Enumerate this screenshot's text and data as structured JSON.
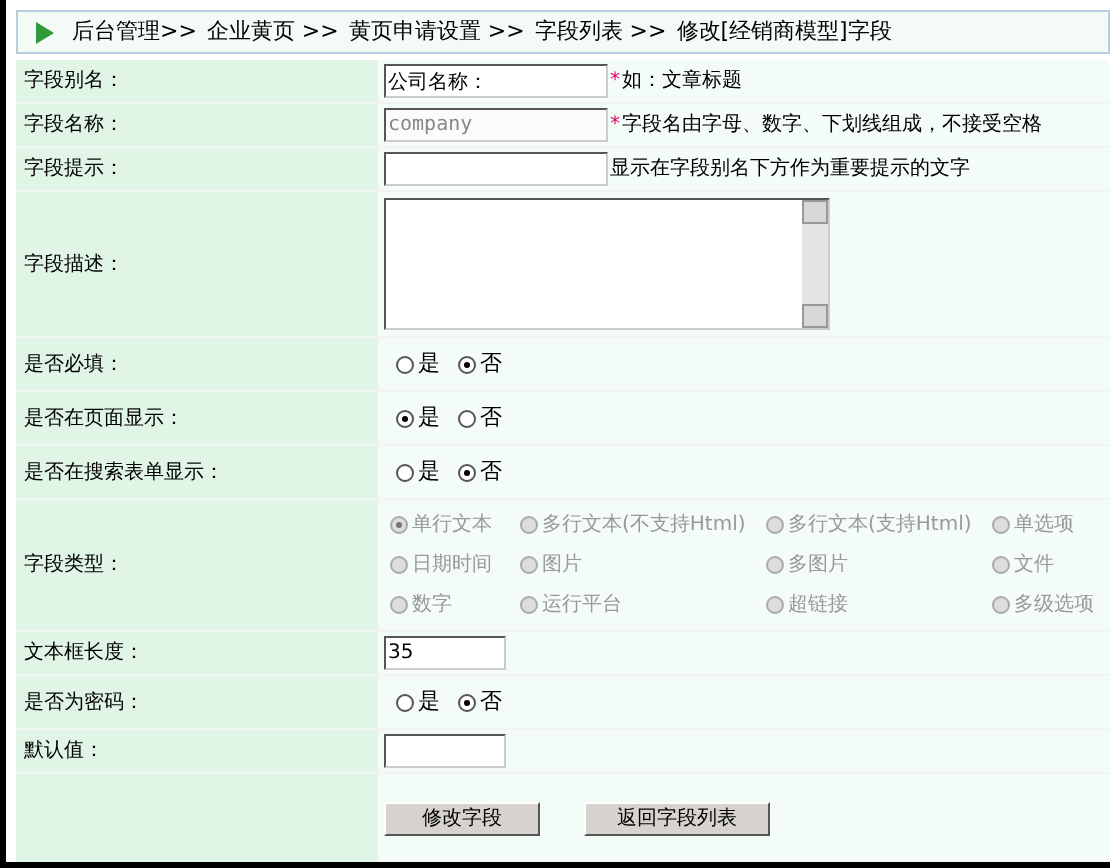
{
  "breadcrumb": [
    "后台管理>>",
    "企业黄页 >>",
    "黄页申请设置 >>",
    "字段列表 >>",
    "修改[经销商模型]字段"
  ],
  "rows": [
    {
      "kind": "text",
      "label": "字段别名：",
      "value": "公司名称：",
      "required_mark": "*",
      "hint": "如：文章标题",
      "disabled": false
    },
    {
      "kind": "text",
      "label": "字段名称：",
      "value": "company",
      "required_mark": "*",
      "hint": "字段名由字母、数字、下划线组成，不接受空格",
      "disabled": true
    },
    {
      "kind": "text",
      "label": "字段提示：",
      "hint": "显示在字段别名下方作为重要提示的文字"
    },
    {
      "kind": "textarea",
      "label": "字段描述："
    },
    {
      "kind": "radio",
      "label": "是否必填：",
      "options": [
        {
          "label": "是",
          "selected": false
        },
        {
          "label": "否",
          "selected": true
        }
      ]
    },
    {
      "kind": "radio",
      "label": "是否在页面显示：",
      "options": [
        {
          "label": "是",
          "selected": true
        },
        {
          "label": "否",
          "selected": false
        }
      ]
    },
    {
      "kind": "radio",
      "label": "是否在搜索表单显示：",
      "options": [
        {
          "label": "是",
          "selected": false
        },
        {
          "label": "否",
          "selected": true
        }
      ]
    },
    {
      "kind": "radio_grid",
      "label": "字段类型：",
      "disabled": true,
      "options": [
        {
          "label": "单行文本",
          "selected": true
        },
        {
          "label": "多行文本(不支持Html)",
          "selected": false
        },
        {
          "label": "多行文本(支持Html)",
          "selected": false
        },
        {
          "label": "单选项",
          "selected": false
        },
        {
          "label": "日期时间",
          "selected": false
        },
        {
          "label": "图片",
          "selected": false
        },
        {
          "label": "多图片",
          "selected": false
        },
        {
          "label": "文件",
          "selected": false
        },
        {
          "label": "数字",
          "selected": false
        },
        {
          "label": "运行平台",
          "selected": false
        },
        {
          "label": "超链接",
          "selected": false
        },
        {
          "label": "多级选项",
          "selected": false
        }
      ]
    },
    {
      "kind": "short_text",
      "label": "文本框长度：",
      "value": "35",
      "disabled": false
    },
    {
      "kind": "radio",
      "label": "是否为密码：",
      "options": [
        {
          "label": "是",
          "selected": false
        },
        {
          "label": "否",
          "selected": true
        }
      ]
    },
    {
      "kind": "short_text",
      "label": "默认值："
    },
    {
      "kind": "buttons",
      "buttons": [
        "修改字段",
        "返回字段列表"
      ]
    }
  ]
}
